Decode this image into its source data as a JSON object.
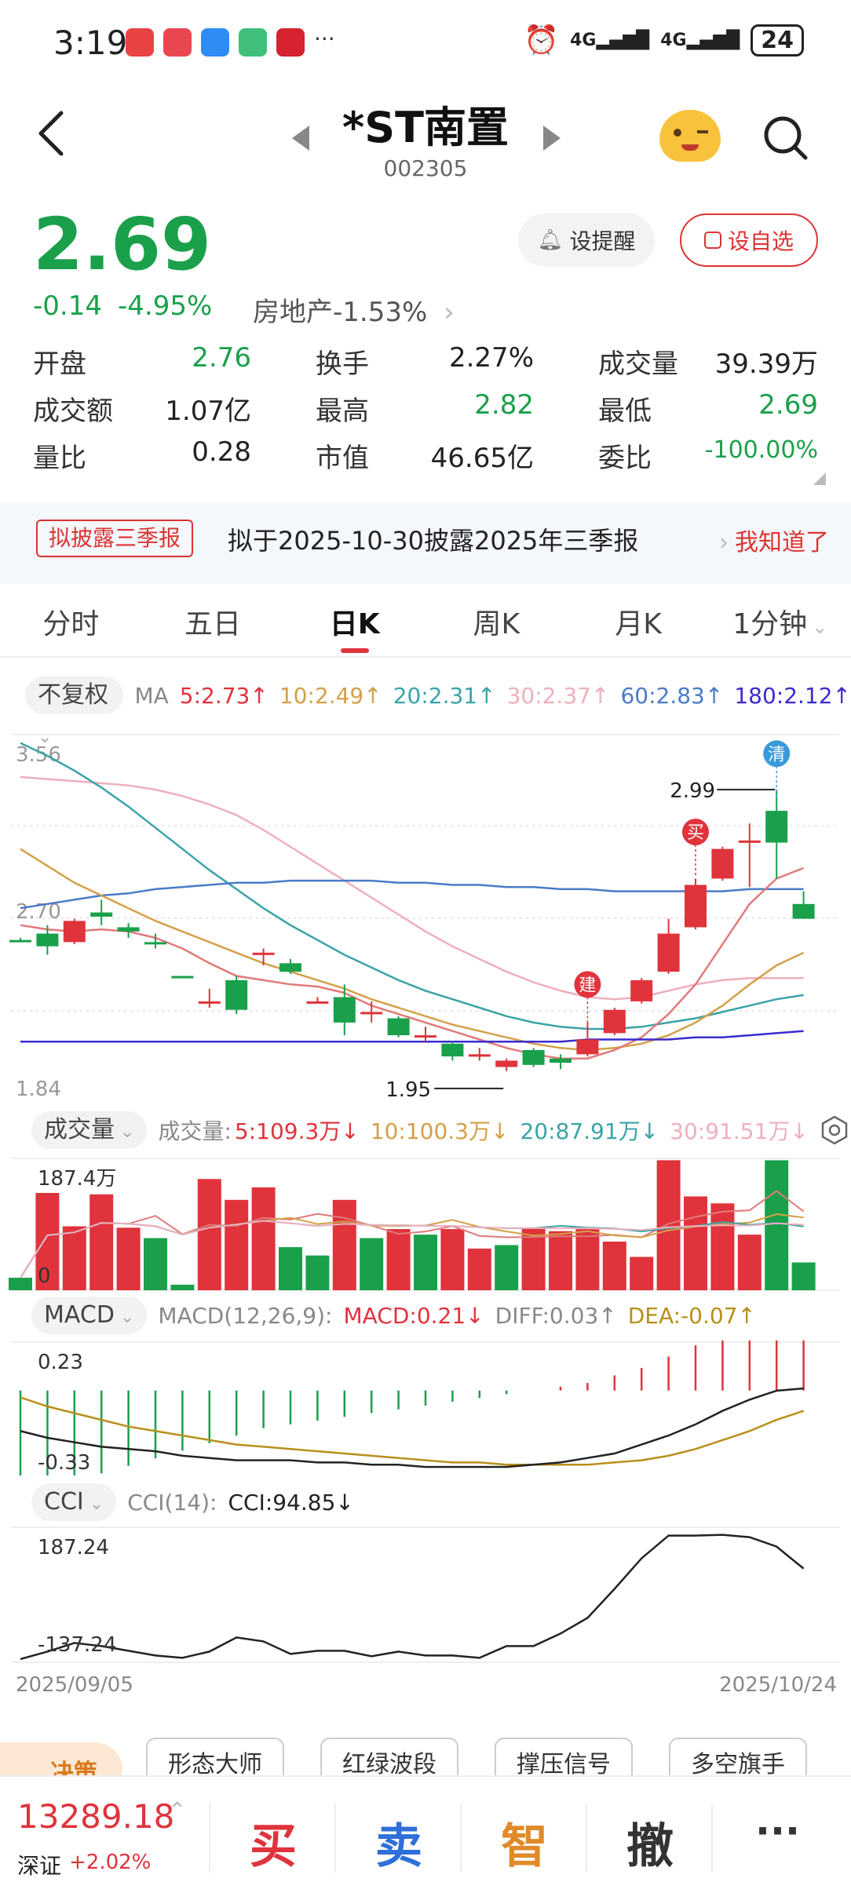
{
  "status_bar": {
    "time": "3:19",
    "signal_a": "4G",
    "signal_b": "4G",
    "battery": "24"
  },
  "header": {
    "title": "*ST南置",
    "code": "002305"
  },
  "quote": {
    "price": "2.69",
    "change": "-0.14",
    "change_pct": "-4.95%",
    "sector": "房地产",
    "sector_pct": "-1.53%",
    "remind_label": "设提醒",
    "fav_label": "设自选"
  },
  "stats": {
    "open_label": "开盘",
    "open": "2.76",
    "turnover_label": "换手",
    "turnover": "2.27%",
    "volume_label": "成交量",
    "volume": "39.39万",
    "amount_label": "成交额",
    "amount": "1.07亿",
    "high_label": "最高",
    "high": "2.82",
    "low_label": "最低",
    "low": "2.69",
    "vol_ratio_label": "量比",
    "vol_ratio": "0.28",
    "mcap_label": "市值",
    "mcap": "46.65亿",
    "bid_ratio_label": "委比",
    "bid_ratio": "-100.00%"
  },
  "notice": {
    "tag": "拟披露三季报",
    "message": "拟于2025-10-30披露2025年三季报",
    "ack": "我知道了"
  },
  "tabs": [
    "分时",
    "五日",
    "日K",
    "周K",
    "月K",
    "1分钟"
  ],
  "ma_bar": {
    "adjust": "不复权",
    "label": "MA",
    "ma5": "5:2.73↑",
    "ma10": "10:2.49↑",
    "ma20": "20:2.31↑",
    "ma30": "30:2.37↑",
    "ma60": "60:2.83↑",
    "ma180": "180:2.12↑"
  },
  "volume_bar": {
    "selector": "成交量",
    "label": "成交量:",
    "v5": "5:109.3万↓",
    "v10": "10:100.3万↓",
    "v20": "20:87.91万↓",
    "v30": "30:91.51万↓"
  },
  "macd_bar": {
    "selector": "MACD",
    "params": "MACD(12,26,9):",
    "macd": "MACD:0.21↓",
    "diff": "DIFF:0.03↑",
    "dea": "DEA:-0.07↑"
  },
  "cci_bar": {
    "selector": "CCI",
    "params": "CCI(14):",
    "cci": "CCI:94.85↓"
  },
  "colors": {
    "up": "#e0333c",
    "down": "#1aa04a",
    "ma5": "#e07a7a",
    "ma10": "#d4a04a",
    "ma20": "#3aa3a8",
    "ma30": "#eeb0bc",
    "ma60": "#4a7bc8",
    "ma180": "#3a2bd0"
  },
  "chart_data": [
    {
      "type": "candlestick",
      "title": "",
      "y_top_label": "3.56",
      "y_mid_label": "2.70",
      "y_bottom_label": "1.84",
      "ylim": [
        1.84,
        3.56
      ],
      "annotations": {
        "high_label": "2.99",
        "low_label": "1.95",
        "build": "建",
        "buy": "买",
        "clear": "清"
      },
      "candles": [
        {
          "o": 2.59,
          "c": 2.59,
          "h": 2.6,
          "l": 2.58
        },
        {
          "o": 2.62,
          "c": 2.56,
          "h": 2.66,
          "l": 2.52
        },
        {
          "o": 2.58,
          "c": 2.68,
          "h": 2.69,
          "l": 2.57
        },
        {
          "o": 2.72,
          "c": 2.7,
          "h": 2.78,
          "l": 2.66
        },
        {
          "o": 2.65,
          "c": 2.63,
          "h": 2.67,
          "l": 2.6
        },
        {
          "o": 2.58,
          "c": 2.57,
          "h": 2.62,
          "l": 2.55
        },
        {
          "o": 2.42,
          "c": 2.42,
          "h": 2.42,
          "l": 2.42
        },
        {
          "o": 2.3,
          "c": 2.3,
          "h": 2.36,
          "l": 2.27
        },
        {
          "o": 2.4,
          "c": 2.26,
          "h": 2.42,
          "l": 2.24
        },
        {
          "o": 2.53,
          "c": 2.53,
          "h": 2.55,
          "l": 2.47
        },
        {
          "o": 2.48,
          "c": 2.44,
          "h": 2.5,
          "l": 2.43
        },
        {
          "o": 2.3,
          "c": 2.3,
          "h": 2.32,
          "l": 2.29
        },
        {
          "o": 2.32,
          "c": 2.2,
          "h": 2.38,
          "l": 2.14
        },
        {
          "o": 2.25,
          "c": 2.25,
          "h": 2.3,
          "l": 2.2
        },
        {
          "o": 2.22,
          "c": 2.14,
          "h": 2.23,
          "l": 2.13
        },
        {
          "o": 2.14,
          "c": 2.14,
          "h": 2.18,
          "l": 2.11
        },
        {
          "o": 2.1,
          "c": 2.04,
          "h": 2.11,
          "l": 2.02
        },
        {
          "o": 2.05,
          "c": 2.05,
          "h": 2.08,
          "l": 2.02
        },
        {
          "o": 1.99,
          "c": 2.02,
          "h": 2.03,
          "l": 1.97
        },
        {
          "o": 2.07,
          "c": 2.0,
          "h": 2.08,
          "l": 1.99
        },
        {
          "o": 2.03,
          "c": 2.01,
          "h": 2.05,
          "l": 1.98
        },
        {
          "o": 2.05,
          "c": 2.12,
          "h": 2.2,
          "l": 2.04
        },
        {
          "o": 2.15,
          "c": 2.26,
          "h": 2.27,
          "l": 2.14
        },
        {
          "o": 2.3,
          "c": 2.4,
          "h": 2.41,
          "l": 2.29
        },
        {
          "o": 2.44,
          "c": 2.62,
          "h": 2.69,
          "l": 2.43
        },
        {
          "o": 2.65,
          "c": 2.85,
          "h": 2.88,
          "l": 2.64
        },
        {
          "o": 2.88,
          "c": 3.02,
          "h": 3.03,
          "l": 2.87
        },
        {
          "o": 3.06,
          "c": 3.06,
          "h": 3.14,
          "l": 2.84
        },
        {
          "o": 3.2,
          "c": 3.05,
          "h": 3.3,
          "l": 2.88
        },
        {
          "o": 2.76,
          "c": 2.69,
          "h": 2.82,
          "l": 2.69
        }
      ],
      "ma5": [
        2.66,
        2.64,
        2.63,
        2.64,
        2.63,
        2.6,
        2.55,
        2.48,
        2.42,
        2.4,
        2.38,
        2.37,
        2.34,
        2.28,
        2.24,
        2.2,
        2.16,
        2.12,
        2.08,
        2.05,
        2.03,
        2.03,
        2.07,
        2.13,
        2.24,
        2.38,
        2.57,
        2.76,
        2.88,
        2.93
      ],
      "ma10": [
        3.02,
        2.94,
        2.86,
        2.8,
        2.74,
        2.68,
        2.63,
        2.58,
        2.53,
        2.48,
        2.44,
        2.4,
        2.36,
        2.31,
        2.27,
        2.23,
        2.19,
        2.16,
        2.13,
        2.1,
        2.08,
        2.07,
        2.08,
        2.1,
        2.14,
        2.2,
        2.28,
        2.38,
        2.47,
        2.53
      ],
      "ma20": [
        3.52,
        3.46,
        3.39,
        3.31,
        3.22,
        3.12,
        3.02,
        2.92,
        2.83,
        2.74,
        2.66,
        2.59,
        2.52,
        2.46,
        2.4,
        2.35,
        2.31,
        2.27,
        2.23,
        2.2,
        2.18,
        2.17,
        2.17,
        2.18,
        2.2,
        2.22,
        2.25,
        2.28,
        2.31,
        2.33
      ],
      "ma30": [
        3.36,
        3.35,
        3.34,
        3.33,
        3.32,
        3.3,
        3.27,
        3.23,
        3.18,
        3.11,
        3.03,
        2.95,
        2.87,
        2.79,
        2.71,
        2.63,
        2.56,
        2.5,
        2.44,
        2.39,
        2.35,
        2.32,
        2.31,
        2.32,
        2.35,
        2.38,
        2.4,
        2.41,
        2.41,
        2.41
      ],
      "ma60": [
        2.74,
        2.76,
        2.78,
        2.8,
        2.81,
        2.83,
        2.84,
        2.85,
        2.86,
        2.86,
        2.87,
        2.87,
        2.87,
        2.87,
        2.86,
        2.86,
        2.85,
        2.85,
        2.84,
        2.84,
        2.83,
        2.83,
        2.82,
        2.82,
        2.82,
        2.82,
        2.82,
        2.83,
        2.83,
        2.83
      ],
      "ma180": [
        2.11,
        2.11,
        2.11,
        2.11,
        2.11,
        2.11,
        2.11,
        2.11,
        2.11,
        2.11,
        2.11,
        2.11,
        2.11,
        2.11,
        2.11,
        2.11,
        2.11,
        2.11,
        2.11,
        2.11,
        2.11,
        2.12,
        2.12,
        2.12,
        2.12,
        2.13,
        2.13,
        2.14,
        2.15,
        2.16
      ]
    },
    {
      "type": "bar",
      "title": "",
      "y_top_label": "187.4万",
      "y_bottom_label": "0",
      "ylim": [
        0,
        187.4
      ],
      "values": [
        18,
        140,
        92,
        138,
        90,
        75,
        8,
        160,
        130,
        148,
        62,
        50,
        130,
        75,
        88,
        80,
        88,
        60,
        65,
        90,
        85,
        88,
        70,
        48,
        187,
        135,
        125,
        80,
        187,
        40
      ],
      "up": [
        false,
        true,
        true,
        true,
        true,
        false,
        false,
        true,
        true,
        true,
        false,
        false,
        true,
        false,
        true,
        false,
        true,
        true,
        false,
        true,
        true,
        true,
        true,
        true,
        true,
        true,
        true,
        true,
        false,
        false
      ]
    },
    {
      "type": "line",
      "title": "",
      "y_top_label": "0.23",
      "y_bottom_label": "-0.33",
      "ylim": [
        -0.33,
        0.23
      ],
      "histogram": [
        -0.3,
        -0.27,
        -0.24,
        -0.22,
        -0.2,
        -0.18,
        -0.16,
        -0.14,
        -0.12,
        -0.1,
        -0.09,
        -0.08,
        -0.07,
        -0.06,
        -0.05,
        -0.04,
        -0.03,
        -0.02,
        -0.01,
        0.0,
        0.01,
        0.02,
        0.04,
        0.06,
        0.09,
        0.12,
        0.15,
        0.19,
        0.21,
        0.21
      ],
      "diff": [
        -0.16,
        -0.19,
        -0.21,
        -0.23,
        -0.24,
        -0.25,
        -0.27,
        -0.28,
        -0.29,
        -0.29,
        -0.29,
        -0.3,
        -0.3,
        -0.31,
        -0.31,
        -0.32,
        -0.32,
        -0.32,
        -0.32,
        -0.31,
        -0.3,
        -0.28,
        -0.26,
        -0.22,
        -0.18,
        -0.13,
        -0.07,
        -0.02,
        0.02,
        0.03
      ],
      "dea": [
        -0.01,
        -0.05,
        -0.08,
        -0.11,
        -0.14,
        -0.16,
        -0.18,
        -0.2,
        -0.22,
        -0.23,
        -0.24,
        -0.25,
        -0.26,
        -0.27,
        -0.28,
        -0.29,
        -0.3,
        -0.3,
        -0.31,
        -0.31,
        -0.31,
        -0.31,
        -0.3,
        -0.29,
        -0.27,
        -0.24,
        -0.2,
        -0.16,
        -0.11,
        -0.07
      ]
    },
    {
      "type": "line",
      "title": "",
      "y_top_label": "187.24",
      "y_bottom_label": "-137.24",
      "ylim": [
        -137.24,
        187.24
      ],
      "values": [
        -137,
        -118,
        -96,
        -104,
        -116,
        -128,
        -134,
        -118,
        -82,
        -92,
        -124,
        -116,
        -116,
        -130,
        -118,
        -128,
        -128,
        -134,
        -104,
        -104,
        -72,
        -32,
        42,
        120,
        178,
        178,
        180,
        174,
        150,
        94
      ],
      "x_start": "2025/09/05",
      "x_end": "2025/10/24"
    }
  ],
  "strategy": {
    "tag": "决策",
    "b1": "形态大师",
    "b2": "红绿波段",
    "b3": "撑压信号",
    "b4": "多空旗手"
  },
  "bottom": {
    "index_value": "13289.18",
    "index_name": "深证",
    "index_change": "+2.02%",
    "buy": "买",
    "sell": "卖",
    "smart": "智",
    "cancel": "撤",
    "more": "···"
  }
}
